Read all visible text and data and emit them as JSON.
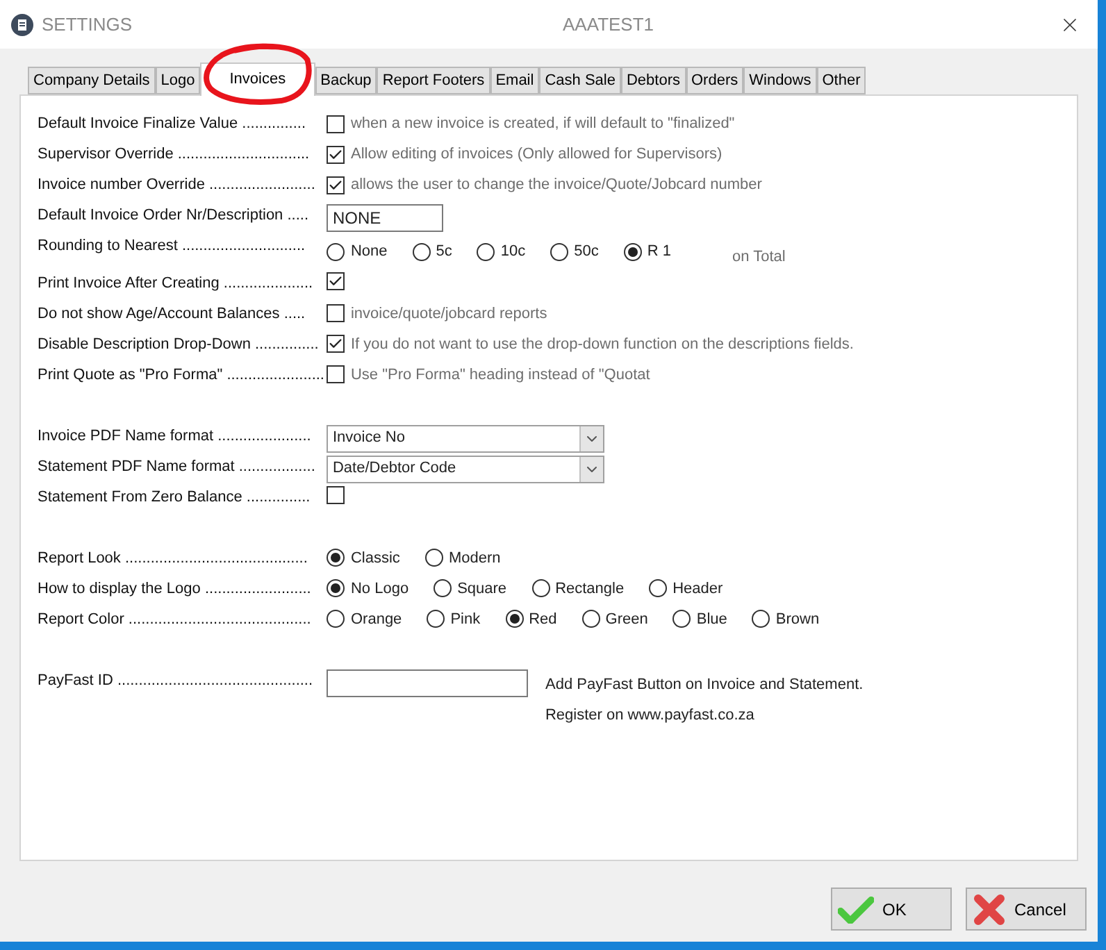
{
  "window": {
    "title": "SETTINGS",
    "subtitle": "AAATEST1"
  },
  "tabs": [
    {
      "label": "Company Details",
      "selected": false
    },
    {
      "label": "Logo",
      "selected": false
    },
    {
      "label": "Invoices",
      "selected": true
    },
    {
      "label": "Backup",
      "selected": false
    },
    {
      "label": "Report Footers",
      "selected": false
    },
    {
      "label": "Email",
      "selected": false
    },
    {
      "label": "Cash Sale",
      "selected": false
    },
    {
      "label": "Debtors",
      "selected": false
    },
    {
      "label": "Orders",
      "selected": false
    },
    {
      "label": "Windows",
      "selected": false
    },
    {
      "label": "Other",
      "selected": false
    }
  ],
  "sections": [
    {
      "rows": [
        {
          "kind": "checkbox",
          "label": "Default Invoice Finalize Value ...............",
          "checked": false,
          "note": "when a new invoice is created, if will default to \"finalized\""
        },
        {
          "kind": "checkbox",
          "label": "Supervisor Override ...............................",
          "checked": true,
          "note": "Allow editing of invoices (Only allowed for Supervisors)"
        },
        {
          "kind": "checkbox",
          "label": "Invoice number Override .........................",
          "checked": true,
          "note": "allows the user to change the invoice/Quote/Jobcard number"
        },
        {
          "kind": "text",
          "label": "Default Invoice Order Nr/Description .....",
          "value": "NONE"
        },
        {
          "kind": "radio",
          "label": "Rounding to Nearest .............................",
          "options": [
            {
              "label": "None",
              "selected": false
            },
            {
              "label": "5c",
              "selected": false
            },
            {
              "label": "10c",
              "selected": false
            },
            {
              "label": "50c",
              "selected": false
            },
            {
              "label": "R 1",
              "selected": true
            }
          ],
          "suffix": "on Total"
        },
        {
          "kind": "checkbox",
          "label": "Print Invoice After Creating .....................",
          "checked": true
        },
        {
          "kind": "checkbox",
          "label": "Do not show Age/Account Balances .....",
          "checked": false,
          "note": "invoice/quote/jobcard reports"
        },
        {
          "kind": "checkbox",
          "label": "Disable Description Drop-Down ...............",
          "checked": true,
          "note": "If you do not want to use the drop-down function on the descriptions fields."
        },
        {
          "kind": "checkbox",
          "label": "Print Quote as \"Pro Forma\" .......................",
          "checked": false,
          "note": "Use \"Pro Forma\" heading instead of \"Quotat"
        }
      ]
    },
    {
      "rows": [
        {
          "kind": "select",
          "label": "Invoice PDF Name format ......................",
          "value": "Invoice No"
        },
        {
          "kind": "select",
          "label": "Statement PDF Name format ..................",
          "value": "Date/Debtor Code"
        },
        {
          "kind": "checkbox",
          "label": "Statement From Zero Balance ...............",
          "checked": false
        }
      ]
    },
    {
      "rows": [
        {
          "kind": "radio",
          "label": "Report Look ...........................................",
          "options": [
            {
              "label": "Classic",
              "selected": true
            },
            {
              "label": "Modern",
              "selected": false
            }
          ]
        },
        {
          "kind": "radio",
          "label": "How to display the Logo .........................",
          "options": [
            {
              "label": "No Logo",
              "selected": true
            },
            {
              "label": "Square",
              "selected": false
            },
            {
              "label": "Rectangle",
              "selected": false
            },
            {
              "label": "Header",
              "selected": false
            }
          ]
        },
        {
          "kind": "radio",
          "label": "Report Color ...........................................",
          "options": [
            {
              "label": "Orange",
              "selected": false
            },
            {
              "label": "Pink",
              "selected": false
            },
            {
              "label": "Red",
              "selected": true
            },
            {
              "label": "Green",
              "selected": false
            },
            {
              "label": "Blue",
              "selected": false
            },
            {
              "label": "Brown",
              "selected": false
            }
          ]
        }
      ]
    },
    {
      "rows": [
        {
          "kind": "field",
          "label": "PayFast ID ..............................................",
          "notes": [
            "Add PayFast Button on Invoice and Statement.",
            "Register on www.payfast.co.za"
          ]
        }
      ]
    }
  ],
  "buttons": [
    {
      "kind": "ok",
      "label": "OK"
    },
    {
      "kind": "cancel",
      "label": "Cancel"
    }
  ]
}
